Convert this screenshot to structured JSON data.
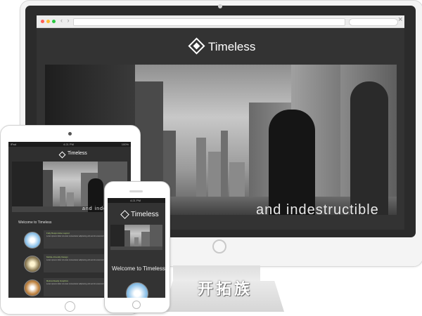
{
  "site": {
    "title": "Timeless",
    "hero_caption": "and indestructible",
    "welcome": "Welcome to Timeless"
  },
  "tablet": {
    "status_left": "iPad",
    "status_time": "4:21 PM",
    "status_right": "100%",
    "features": [
      {
        "heading": "Fully Responsive Layout",
        "text": "Lorem ipsum dolor sit amet consectetur adipiscing elit sed do eiusmod tempor",
        "link": "read more"
      },
      {
        "heading": "Mobile-Friendly Design",
        "text": "Lorem ipsum dolor sit amet consectetur adipiscing elit sed do eiusmod tempor",
        "link": "read more"
      },
      {
        "heading": "Retina Ready Graphics",
        "text": "Lorem ipsum dolor sit amet consectetur adipiscing elit sed do eiusmod tempor",
        "link": "read more"
      }
    ]
  },
  "phone": {
    "status_time": "4:21 PM"
  },
  "watermark": "开拓族",
  "colors": {
    "site_bg": "#333333",
    "accent_green": "#b4d77a",
    "device_white": "#f4f4f4"
  }
}
